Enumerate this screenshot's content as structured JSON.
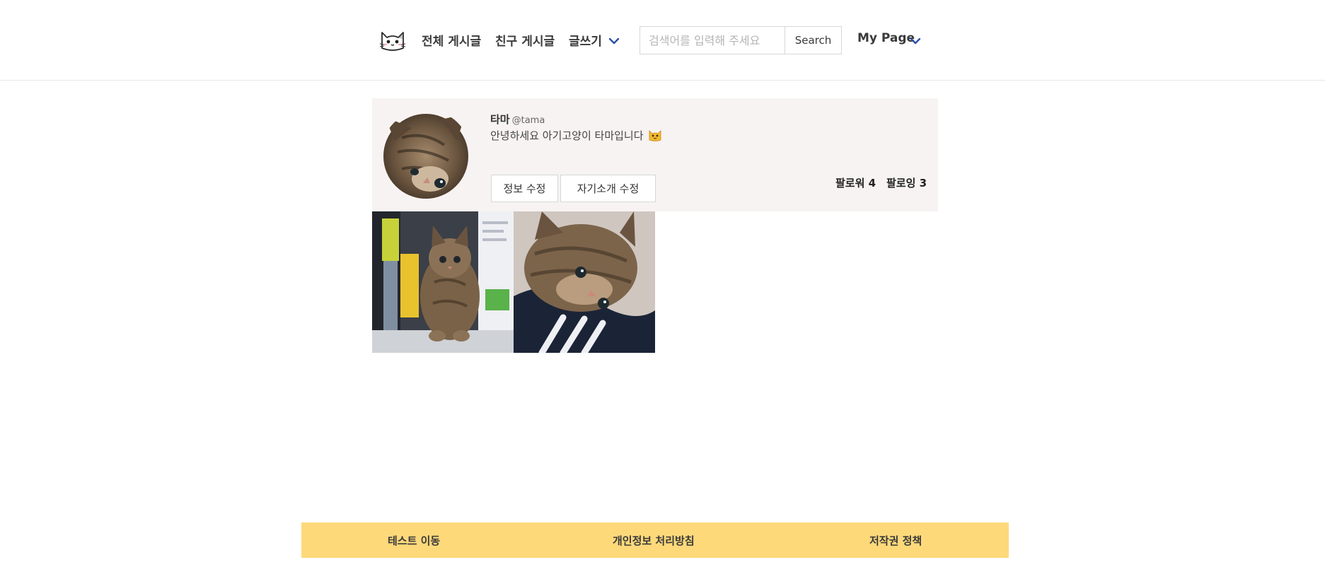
{
  "header": {
    "logo_icon": "cat-face-icon",
    "nav": {
      "all_posts": "전체 게시글",
      "friend_posts": "친구 게시글",
      "write": "글쓰기",
      "my_page": "My Page"
    },
    "search": {
      "placeholder": "검색어를 입력해 주세요",
      "value": "",
      "button_label": "Search"
    },
    "dropdown_icon": "chevron-down-icon",
    "accent_color": "#2b4fa8"
  },
  "profile": {
    "name": "타마",
    "handle": "@tama",
    "bio": "안녕하세요 아기고양이 타마입니다",
    "bio_emoji": "cat-face-emoji",
    "edit_info_label": "정보 수정",
    "edit_intro_label": "자기소개 수정",
    "followers": "팔로워 4",
    "following": "팔로잉 3",
    "avatar": "kitten-photo",
    "background_color": "#f7f3f2"
  },
  "posts": [
    {
      "image": "kitten-at-laptop-photo"
    },
    {
      "image": "kitten-on-jacket-photo"
    }
  ],
  "footer": {
    "test_move": "테스트 이동",
    "privacy_policy": "개인정보 처리방침",
    "copyright_policy": "저작권 정책",
    "background_color": "#fed97a"
  }
}
